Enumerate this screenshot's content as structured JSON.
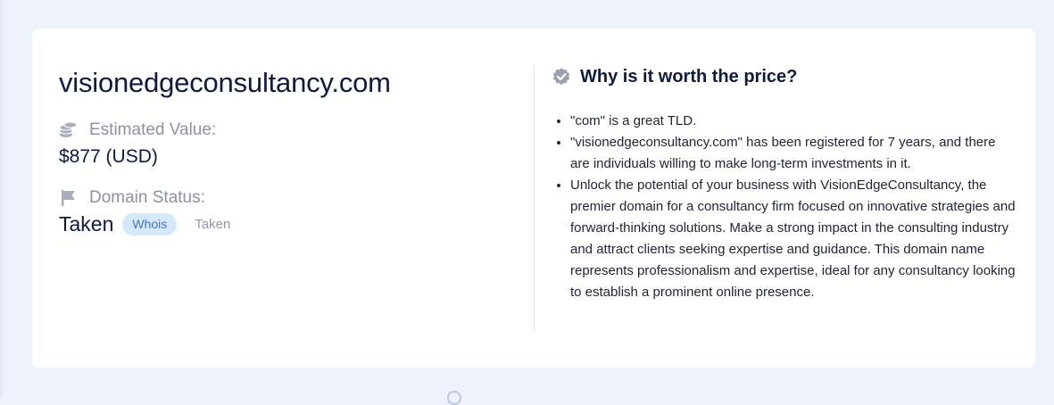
{
  "domain": {
    "name": "visionedgeconsultancy.com"
  },
  "estimated_value": {
    "label": "Estimated Value:",
    "value": "$877 (USD)",
    "icon": "coins-stack-icon"
  },
  "domain_status": {
    "label": "Domain Status:",
    "value": "Taken",
    "whois_label": "Whois",
    "secondary": "Taken",
    "icon": "flag-icon"
  },
  "why": {
    "title": "Why is it worth the price?",
    "icon": "verified-badge-icon",
    "reasons": [
      "\"com\" is a great TLD.",
      "\"visionedgeconsultancy.com\" has been registered for 7 years, and there are individuals willing to make long-term investments in it.",
      "Unlock the potential of your business with VisionEdgeConsultancy, the premier domain for a consultancy firm focused on innovative strategies and forward-thinking solutions. Make a strong impact in the consulting industry and attract clients seeking expertise and guidance. This domain name represents professionalism and expertise, ideal for any consultancy looking to establish a prominent online presence."
    ]
  },
  "colors": {
    "background": "#edf2fc",
    "card": "#ffffff",
    "text": "#0f1a3d",
    "muted": "#8c92a4",
    "badge_bg": "#d6e8fb",
    "badge_text": "#4077c2"
  }
}
